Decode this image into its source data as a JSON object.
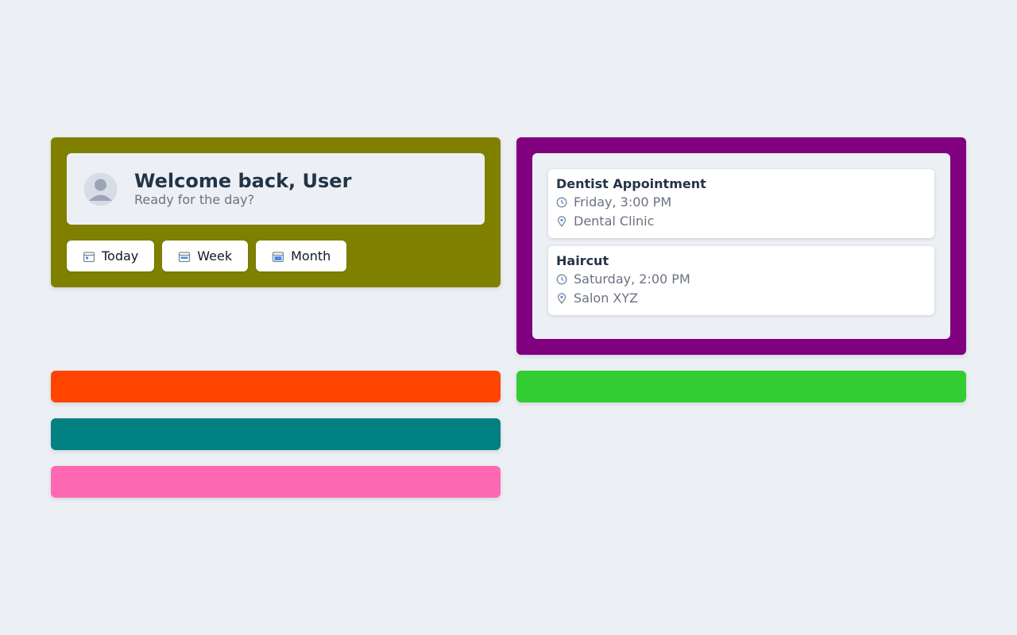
{
  "colors": {
    "background": "#ecf0f5",
    "welcome_panel": "#808000",
    "appointments_panel": "#800080",
    "bar_orange": "#ff4500",
    "bar_green": "#32cd32",
    "bar_teal": "#008080",
    "bar_pink": "#ff69b4"
  },
  "welcome": {
    "avatar_alt": "User Avatar",
    "title": "Welcome back, User",
    "subtitle": "Ready for the day?"
  },
  "views": [
    {
      "label": "Today",
      "icon": "calendar-day-icon"
    },
    {
      "label": "Week",
      "icon": "calendar-week-icon"
    },
    {
      "label": "Month",
      "icon": "calendar-month-icon"
    }
  ],
  "appointments": [
    {
      "title": "Dentist Appointment",
      "time": "Friday, 3:00 PM",
      "location": "Dental Clinic",
      "time_icon": "clock-icon",
      "location_icon": "location-pin-icon"
    },
    {
      "title": "Haircut",
      "time": "Saturday, 2:00 PM",
      "location": "Salon XYZ",
      "time_icon": "clock-icon",
      "location_icon": "location-pin-icon"
    }
  ]
}
